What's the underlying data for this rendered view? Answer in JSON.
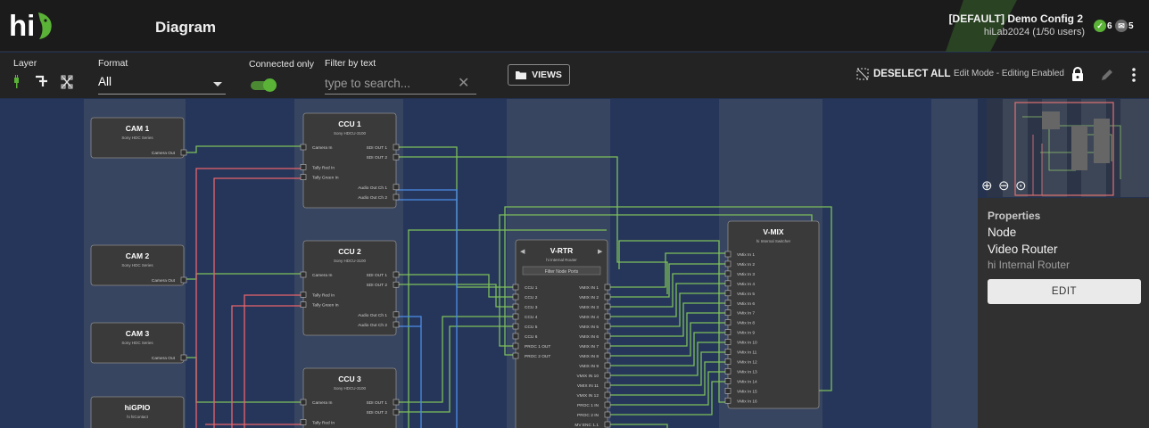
{
  "header": {
    "logo_text": "hi",
    "page_title": "Diagram",
    "config_title": "[DEFAULT] Demo Config 2",
    "config_sub": "hiLab2024 (1/50 users)",
    "badge_ok_count": "6",
    "badge_msg_count": "5"
  },
  "toolbar": {
    "layer_label": "Layer",
    "format_label": "Format",
    "format_value": "All",
    "connected_label": "Connected only",
    "filter_label": "Filter by text",
    "filter_placeholder": "type to search...",
    "views_label": "VIEWS",
    "deselect_label": "DESELECT ALL",
    "edit_mode_label": "Edit Mode - Editing Enabled"
  },
  "properties": {
    "heading": "Properties",
    "type": "Node",
    "name": "Video Router",
    "desc": "hi Internal Router",
    "edit_label": "EDIT"
  },
  "colors": {
    "green_wire": "#7dbf5a",
    "red_wire": "#e8646b",
    "blue_wire": "#4c8de8",
    "node_bg": "#3a3a3a",
    "accent_green": "#5ab237"
  },
  "nodes": [
    {
      "id": "cam1",
      "title": "CAM 1",
      "subtitle": "Sony HDC Series",
      "left_ports": [],
      "right_ports": [
        "Camera Out"
      ]
    },
    {
      "id": "cam2",
      "title": "CAM 2",
      "subtitle": "Sony HDC Series",
      "left_ports": [],
      "right_ports": [
        "Camera Out"
      ]
    },
    {
      "id": "cam3",
      "title": "CAM 3",
      "subtitle": "Sony HDC Series",
      "left_ports": [],
      "right_ports": [
        "Camera Out"
      ]
    },
    {
      "id": "higpio",
      "title": "hiGPIO",
      "subtitle": "hi hiContact",
      "left_ports": [],
      "right_ports": []
    },
    {
      "id": "ccu1",
      "title": "CCU 1",
      "subtitle": "Sony HDCU-3100",
      "rows": [
        [
          "Camera In",
          "SDI OUT 1"
        ],
        [
          "",
          "SDI OUT 2"
        ],
        [
          "Tally Red In",
          ""
        ],
        [
          "Tally Green In",
          ""
        ],
        [
          "",
          "Audio Out Ch 1"
        ],
        [
          "",
          "Audio Out Ch 2"
        ]
      ]
    },
    {
      "id": "ccu2",
      "title": "CCU 2",
      "subtitle": "Sony HDCU-3100",
      "rows": [
        [
          "Camera In",
          "SDI OUT 1"
        ],
        [
          "",
          "SDI OUT 2"
        ],
        [
          "Tally Red In",
          ""
        ],
        [
          "Tally Green In",
          ""
        ],
        [
          "",
          "Audio Out Ch 1"
        ],
        [
          "",
          "Audio Out Ch 2"
        ]
      ]
    },
    {
      "id": "ccu3",
      "title": "CCU 3",
      "subtitle": "Sony HDCU-3100",
      "rows": [
        [
          "Camera In",
          "SDI OUT 1"
        ],
        [
          "",
          "SDI OUT 2"
        ],
        [
          "Tally Red In",
          ""
        ]
      ]
    },
    {
      "id": "vrtr",
      "title": "V-RTR",
      "subtitle": "hi Internal Router",
      "filter_label": "Filter Node Ports",
      "rows": [
        [
          "CCU 1",
          "VMIX IN 1"
        ],
        [
          "CCU 2",
          "VMIX IN 2"
        ],
        [
          "CCU 3",
          "VMIX IN 3"
        ],
        [
          "CCU 4",
          "VMIX IN 4"
        ],
        [
          "CCU 5",
          "VMIX IN 5"
        ],
        [
          "CCU 6",
          "VMIX IN 6"
        ],
        [
          "PROC 1 OUT",
          "VMIX IN 7"
        ],
        [
          "PROC 2 OUT",
          "VMIX IN 8"
        ],
        [
          "",
          "VMIX IN 9"
        ],
        [
          "",
          "VMIX IN 10"
        ],
        [
          "",
          "VMIX IN 11"
        ],
        [
          "",
          "VMIX IN 12"
        ],
        [
          "",
          "PROC 1 IN"
        ],
        [
          "",
          "PROC 2 IN"
        ],
        [
          "",
          "MV ENC 1.1"
        ]
      ]
    },
    {
      "id": "vmix",
      "title": "V-MIX",
      "subtitle": "hi Internal Switcher",
      "rows": [
        [
          "VMix In 1",
          ""
        ],
        [
          "VMix In 2",
          ""
        ],
        [
          "VMix In 3",
          ""
        ],
        [
          "VMix In 4",
          ""
        ],
        [
          "VMix In 5",
          ""
        ],
        [
          "VMix In 6",
          ""
        ],
        [
          "VMix In 7",
          ""
        ],
        [
          "VMix In 8",
          ""
        ],
        [
          "VMix In 9",
          ""
        ],
        [
          "VMix In 10",
          ""
        ],
        [
          "VMix In 11",
          ""
        ],
        [
          "VMix In 12",
          ""
        ],
        [
          "VMix In 13",
          ""
        ],
        [
          "VMix In 14",
          ""
        ],
        [
          "VMix In 15",
          ""
        ],
        [
          "VMix In 16",
          ""
        ]
      ]
    }
  ]
}
